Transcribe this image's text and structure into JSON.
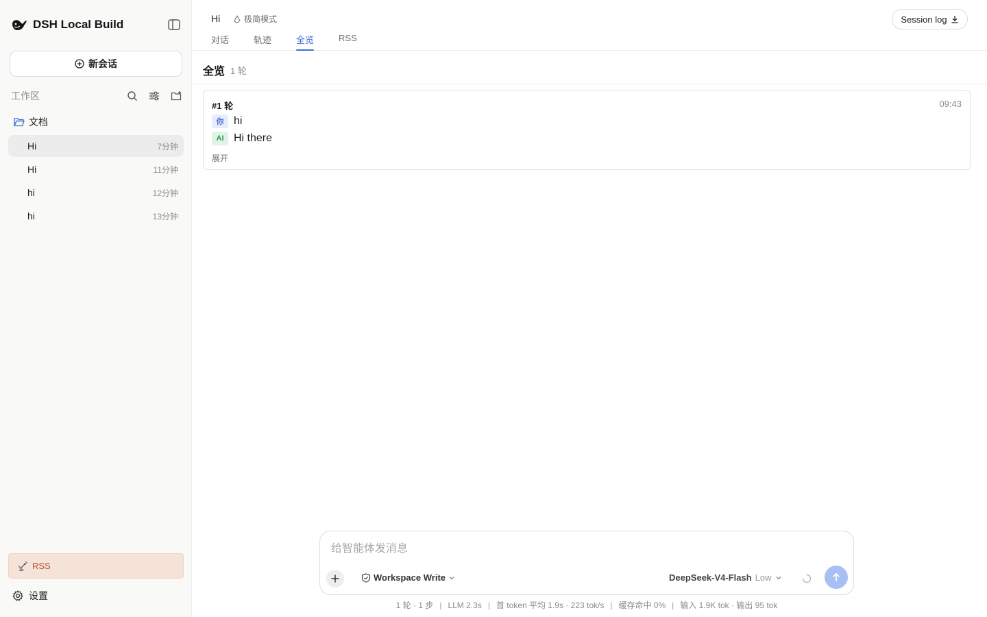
{
  "sidebar": {
    "brand": "DSH Local Build",
    "new_chat": "新会话",
    "workspace_label": "工作区",
    "folder": "文档",
    "sessions": [
      {
        "title": "Hi",
        "time": "7分钟"
      },
      {
        "title": "Hi",
        "time": "11分钟"
      },
      {
        "title": "hi",
        "time": "12分钟"
      },
      {
        "title": "hi",
        "time": "13分钟"
      }
    ],
    "rss": "RSS",
    "settings": "设置"
  },
  "header": {
    "session_title": "Hi",
    "mode": "极简模式",
    "tabs": [
      {
        "label": "对话"
      },
      {
        "label": "轨迹"
      },
      {
        "label": "全览"
      },
      {
        "label": "RSS"
      }
    ],
    "active_tab": "全览",
    "session_log": "Session log"
  },
  "overview": {
    "title": "全览",
    "count": "1 轮",
    "rounds": [
      {
        "label": "#1 轮",
        "time": "09:43",
        "user_badge": "你",
        "user_text": "hi",
        "ai_badge": "AI",
        "ai_text": "Hi there",
        "expand": "展开"
      }
    ]
  },
  "composer": {
    "placeholder": "给智能体发消息",
    "value": "",
    "permission": "Workspace Write",
    "model": "DeepSeek-V4-Flash",
    "level": "Low"
  },
  "stats": {
    "turns": "1 轮 · 1 步",
    "llm": "LLM 2.3s",
    "first_token": "首 token 平均 1.9s · 223 tok/s",
    "cache": "缓存命中 0%",
    "tokens": "输入 1.9K tok · 输出 95 tok"
  },
  "colors": {
    "accent": "#3b6fd4",
    "rss_bg": "#f6e3d7",
    "rss_text": "#b5532a",
    "send": "#a7bff5"
  }
}
